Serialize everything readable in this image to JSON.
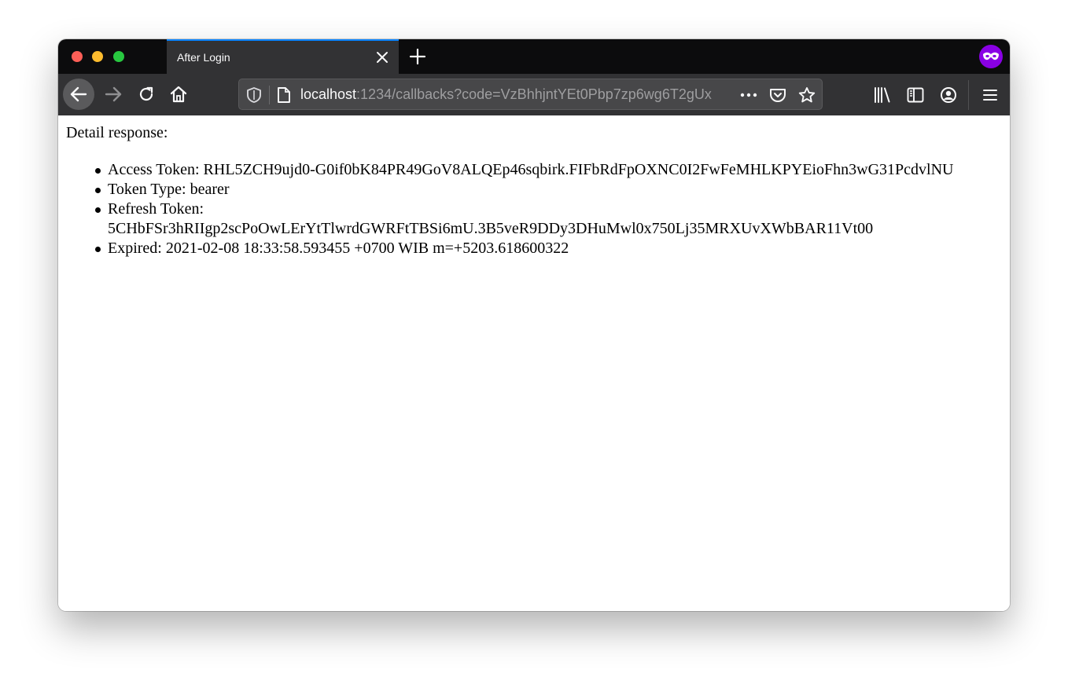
{
  "browser": {
    "tab": {
      "title": "After Login",
      "close_icon": "close-icon"
    },
    "new_tab_icon": "plus-icon",
    "private_icon": "private-mask-icon",
    "nav": {
      "back_icon": "arrow-left-icon",
      "forward_icon": "arrow-right-icon",
      "reload_icon": "reload-icon",
      "home_icon": "home-icon"
    },
    "url": {
      "host": "localhost",
      "rest": ":1234/callbacks?code=VzBhhjntYEt0Pbp7zp6wg6T2gUx"
    },
    "toolbar_icons": [
      "library-icon",
      "sidebar-icon",
      "account-icon",
      "hamburger-menu-icon"
    ],
    "accent_color": "#0a84ff",
    "private_color": "#8a00e5"
  },
  "page": {
    "heading": "Detail response:",
    "items": [
      {
        "line1": "Access Token: RHL5ZCH9ujd0-G0if0bK84PR49GoV8ALQEp46sqbirk.FIFbRdFpOXNC0I2FwFeMHLKPYEioFhn3wG31PcdvlNU"
      },
      {
        "line1": "Token Type: bearer"
      },
      {
        "line1": "Refresh Token:",
        "line2": "5CHbFSr3hRIIgp2scPoOwLErYtTlwrdGWRFtTBSi6mU.3B5veR9DDy3DHuMwl0x750Lj35MRXUvXWbBAR11Vt00"
      },
      {
        "line1": "Expired: 2021-02-08 18:33:58.593455 +0700 WIB m=+5203.618600322"
      }
    ]
  }
}
